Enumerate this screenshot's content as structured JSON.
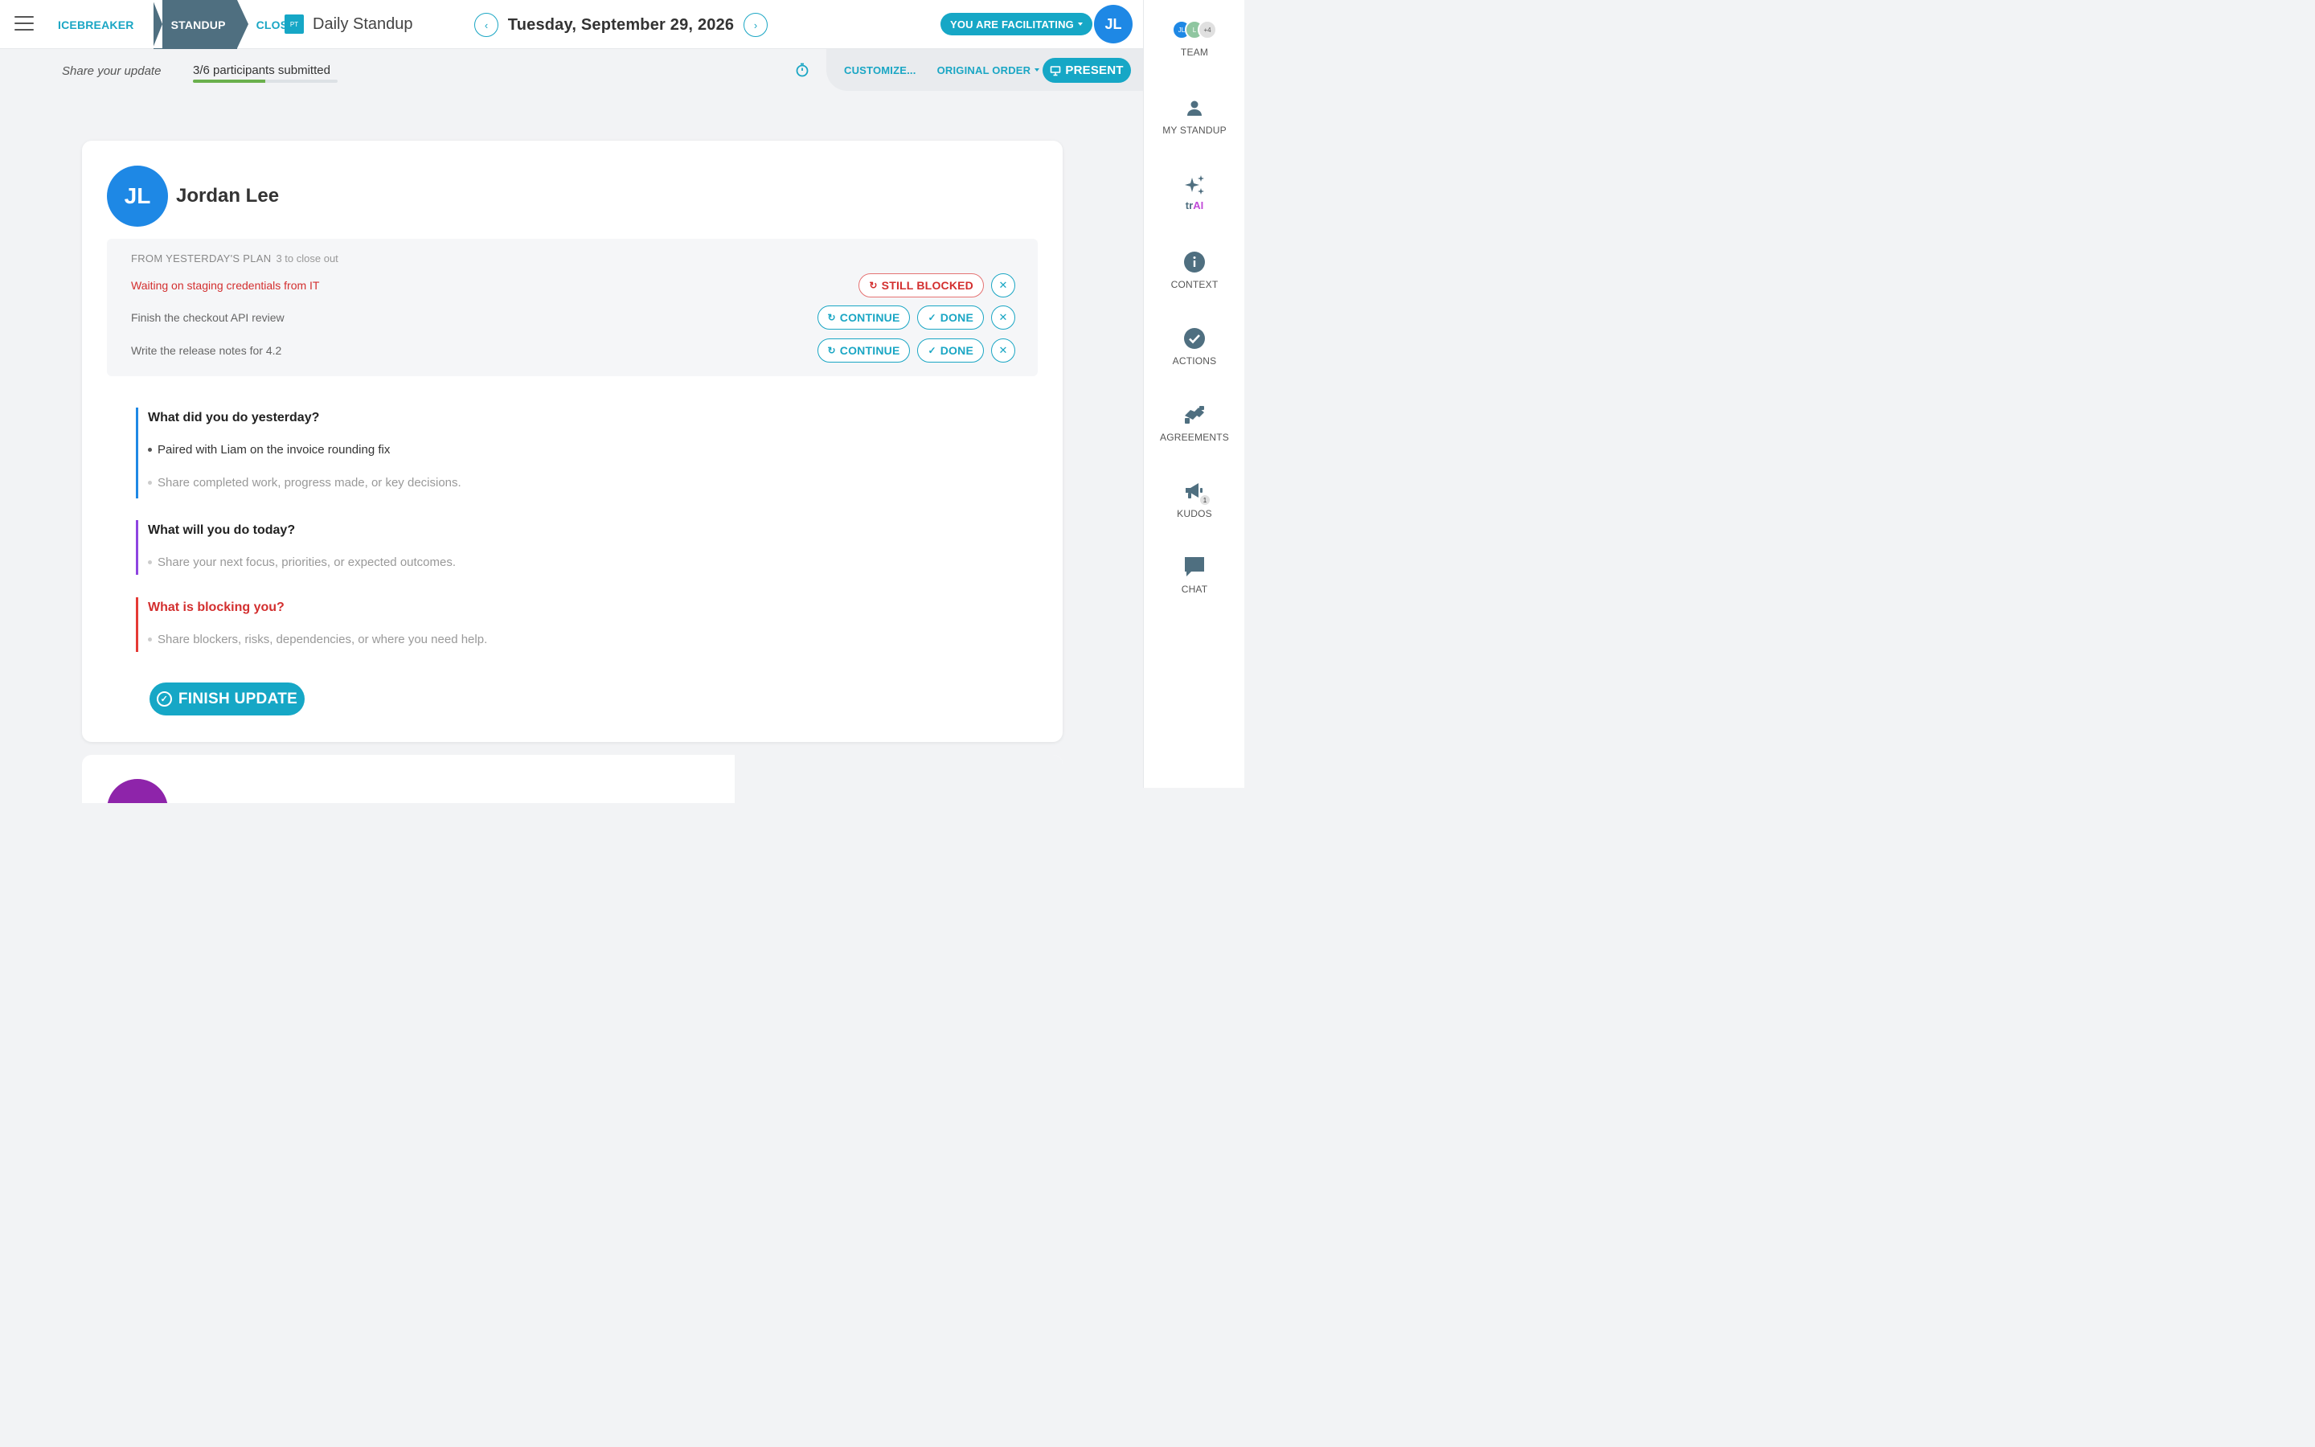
{
  "header": {
    "steps": [
      "ICEBREAKER",
      "STANDUP",
      "CLOSE"
    ],
    "meeting_badge": "PT",
    "meeting_title": "Daily Standup",
    "date": "Tuesday, September 29, 2026",
    "prev_glyph": "‹",
    "next_glyph": "›",
    "facilitating_label": "YOU ARE FACILITATING",
    "user_initials": "JL"
  },
  "subbar": {
    "share_label": "Share your update",
    "progress_text": "3/6 participants submitted",
    "progress_fraction": 0.5,
    "customize_label": "CUSTOMIZE...",
    "order_label": "ORIGINAL ORDER",
    "present_label": "PRESENT"
  },
  "card": {
    "initials": "JL",
    "name": "Jordan Lee",
    "plan_heading": "FROM YESTERDAY'S PLAN",
    "plan_sub": "3 to close out",
    "plan_items": [
      {
        "text": "Waiting on staging credentials from IT",
        "blocked": true
      },
      {
        "text": "Finish the checkout API review",
        "blocked": false
      },
      {
        "text": "Write the release notes for 4.2",
        "blocked": false
      }
    ],
    "buttons": {
      "still_blocked": "STILL BLOCKED",
      "continue": "CONTINUE",
      "done": "DONE",
      "remove": "✕"
    },
    "questions": [
      {
        "title": "What did you do yesterday?",
        "items": [
          "Paired with Liam on the invoice rounding fix"
        ],
        "placeholder": "Share completed work, progress made, or key decisions.",
        "color": "#1e88e5"
      },
      {
        "title": "What will you do today?",
        "items": [],
        "placeholder": "Share your next focus, priorities, or expected outcomes.",
        "color": "#8e44e0"
      },
      {
        "title": "What is blocking you?",
        "items": [],
        "placeholder": "Share blockers, risks, dependencies, or where you need help.",
        "color": "#e53935"
      }
    ],
    "finish_label": "FINISH UPDATE"
  },
  "sidebar": {
    "team_avatars": [
      "JL",
      "L",
      "+4"
    ],
    "team_label": "TEAM",
    "my_standup_label": "MY STANDUP",
    "trai_prefix": "tr",
    "trai_suffix": "AI",
    "context_label": "CONTEXT",
    "actions_label": "ACTIONS",
    "agreements_label": "AGREEMENTS",
    "kudos_label": "KUDOS",
    "kudos_count": "1",
    "chat_label": "CHAT"
  },
  "colors": {
    "accent": "#16a7c6",
    "primary_blue": "#1e88e5",
    "blocked_red": "#d32f2f",
    "progress_green": "#6ab04c",
    "step_active": "#4f6f80"
  }
}
